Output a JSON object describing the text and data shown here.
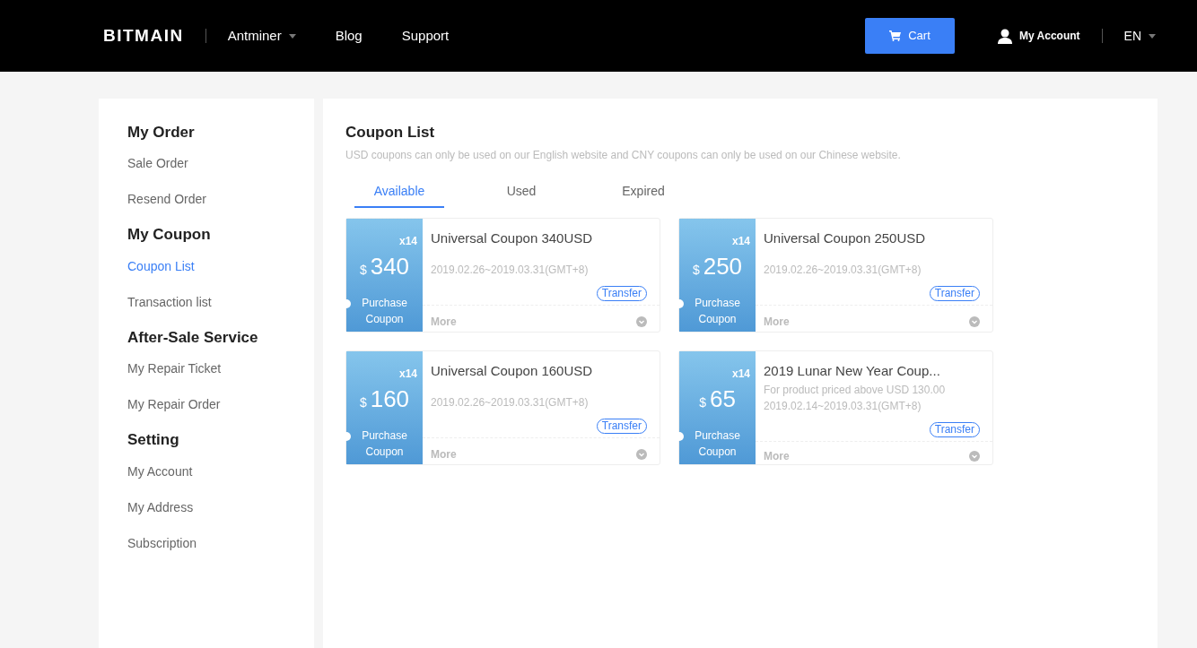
{
  "header": {
    "logo": "BITMAIN",
    "nav": [
      {
        "label": "Antminer",
        "dropdown": true
      },
      {
        "label": "Blog",
        "dropdown": false
      },
      {
        "label": "Support",
        "dropdown": false
      }
    ],
    "cart": "Cart",
    "account": "My Account",
    "language": "EN"
  },
  "sidebar": [
    {
      "title": "My Order",
      "items": [
        {
          "label": "Sale Order",
          "selected": false
        },
        {
          "label": "Resend Order",
          "selected": false
        }
      ]
    },
    {
      "title": "My Coupon",
      "items": [
        {
          "label": "Coupon List",
          "selected": true
        },
        {
          "label": "Transaction list",
          "selected": false
        }
      ]
    },
    {
      "title": "After-Sale Service",
      "items": [
        {
          "label": "My Repair Ticket",
          "selected": false
        },
        {
          "label": "My Repair Order",
          "selected": false
        }
      ]
    },
    {
      "title": "Setting",
      "items": [
        {
          "label": "My Account",
          "selected": false
        },
        {
          "label": "My Address",
          "selected": false
        },
        {
          "label": "Subscription",
          "selected": false
        }
      ]
    }
  ],
  "main": {
    "title": "Coupon List",
    "note": "USD coupons can only be used on our English website and CNY coupons can only be used on our Chinese website.",
    "tabs": [
      {
        "label": "Available",
        "selected": true
      },
      {
        "label": "Used",
        "selected": false
      },
      {
        "label": "Expired",
        "selected": false
      }
    ],
    "coupons": [
      {
        "count": "x14",
        "currency": "$",
        "amount": "340",
        "action": "Purchase Coupon",
        "title": "Universal Coupon 340USD",
        "dates": "2019.02.26~2019.03.31(GMT+8)",
        "transfer": "Transfer",
        "more": "More"
      },
      {
        "count": "x14",
        "currency": "$",
        "amount": "250",
        "action": "Purchase Coupon",
        "title": "Universal Coupon 250USD",
        "dates": "2019.02.26~2019.03.31(GMT+8)",
        "transfer": "Transfer",
        "more": "More"
      },
      {
        "count": "x14",
        "currency": "$",
        "amount": "160",
        "action": "Purchase Coupon",
        "title": "Universal Coupon 160USD",
        "dates": "2019.02.26~2019.03.31(GMT+8)",
        "transfer": "Transfer",
        "more": "More"
      },
      {
        "count": "x14",
        "currency": "$",
        "amount": "65",
        "action": "Purchase Coupon",
        "title": "2019 Lunar New Year Coup...",
        "condition": "For product priced above USD 130.00",
        "dates": "2019.02.14~2019.03.31(GMT+8)",
        "transfer": "Transfer",
        "more": "More"
      }
    ]
  }
}
